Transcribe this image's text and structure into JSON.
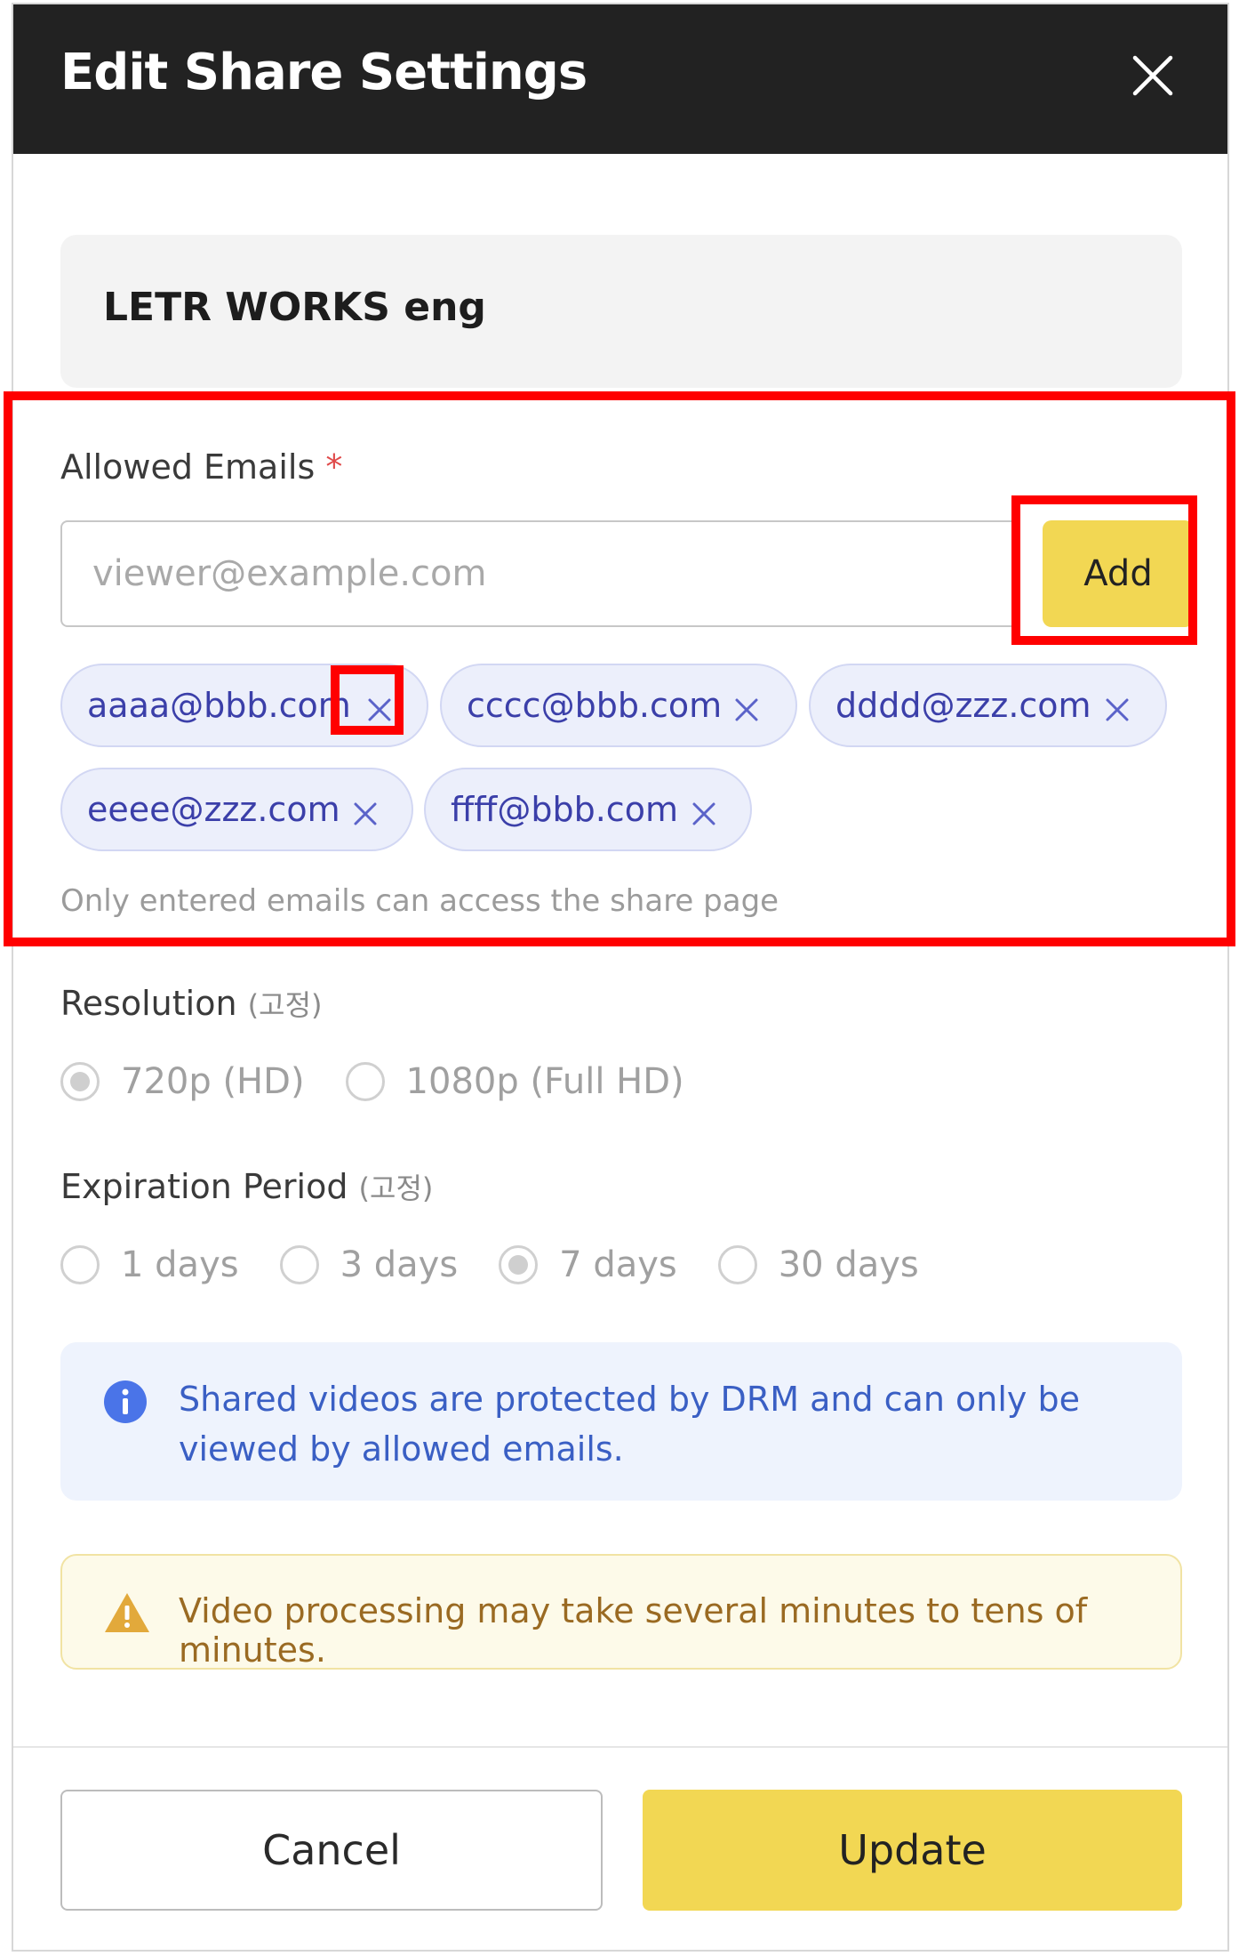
{
  "dialog": {
    "title": "Edit Share Settings",
    "project_name": "LETR WORKS eng"
  },
  "emails": {
    "label": "Allowed Emails",
    "required_mark": "*",
    "input_placeholder": "viewer@example.com",
    "input_value": "",
    "add_label": "Add",
    "chips": [
      "aaaa@bbb.com",
      "cccc@bbb.com",
      "dddd@zzz.com",
      "eeee@zzz.com",
      "ffff@bbb.com"
    ],
    "helper": "Only entered emails can access the share page"
  },
  "resolution": {
    "label": "Resolution",
    "sub": "(고정)",
    "options": [
      "720p (HD)",
      "1080p (Full HD)"
    ],
    "selected": "720p (HD)"
  },
  "expiration": {
    "label": "Expiration Period",
    "sub": "(고정)",
    "options": [
      "1 days",
      "3 days",
      "7 days",
      "30 days"
    ],
    "selected": "7 days"
  },
  "info": {
    "text": "Shared videos are protected by DRM and can only be viewed by allowed emails."
  },
  "warning": {
    "text": "Video processing may take several minutes to tens of minutes."
  },
  "footer": {
    "cancel_label": "Cancel",
    "update_label": "Update"
  },
  "colors": {
    "header_bg": "#222222",
    "accent_yellow": "#f2d753",
    "chip_text": "#3b3fa9",
    "highlight_red": "#ff0000"
  }
}
